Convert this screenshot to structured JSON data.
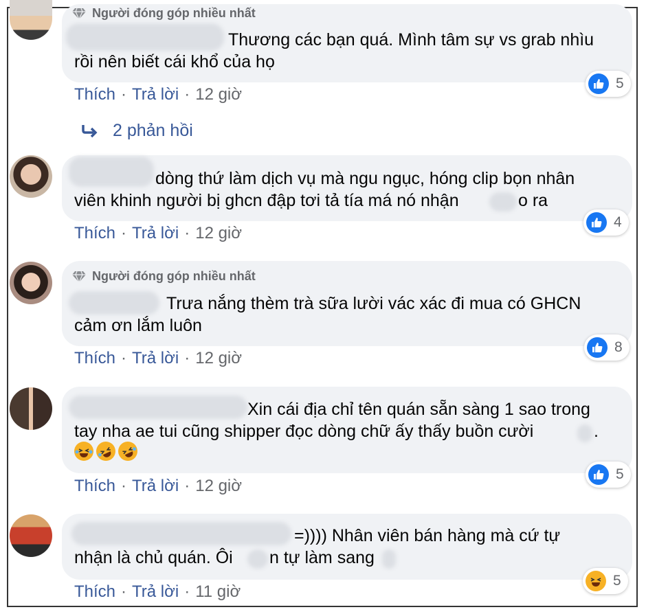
{
  "badge_label": "Người đóng góp nhiều nhất",
  "actions": {
    "like": "Thích",
    "reply": "Trả lời",
    "sep": "·"
  },
  "replies_label": "2 phản hồi",
  "comments": [
    {
      "badge": true,
      "line1": "Thương các bạn quá. Mình tâm sự vs grab nhìu",
      "line2": "rồi nên biết cái khổ của họ",
      "time": "12 giờ",
      "reaction": "like",
      "count": "5"
    },
    {
      "badge": false,
      "line1": "dòng thứ làm dịch vụ mà ngu ngục, hóng clip bọn nhân",
      "line2": "viên khinh người bị ghcn đập tơi tả tía má nó nhận",
      "line2_tail": "o ra",
      "time": "12 giờ",
      "reaction": "like",
      "count": "4"
    },
    {
      "badge": true,
      "line1": "Trưa nắng thèm trà sữa lười vác xác đi mua có GHCN",
      "line2": "cảm ơn lắm luôn",
      "time": "12 giờ",
      "reaction": "like",
      "count": "8"
    },
    {
      "badge": false,
      "line1": "Xin cái địa chỉ tên quán sẵn sàng 1 sao trong",
      "line2": "tay nha ae tui cũng shipper đọc dòng chữ ấy thấy buồn cười",
      "line2_tail": ".",
      "line3": "",
      "time": "12 giờ",
      "reaction": "like",
      "count": "5"
    },
    {
      "badge": false,
      "line1": "=)))) Nhân viên bán hàng mà cứ tự",
      "line2": "nhận là chủ quán. Ôi",
      "line2_mid": "n tự làm sang",
      "time": "11 giờ",
      "reaction": "haha",
      "count": "5"
    }
  ],
  "colors": {
    "link": "#385898",
    "bubble": "#f0f2f5",
    "like": "#1877f2",
    "haha": "#f7b125"
  }
}
